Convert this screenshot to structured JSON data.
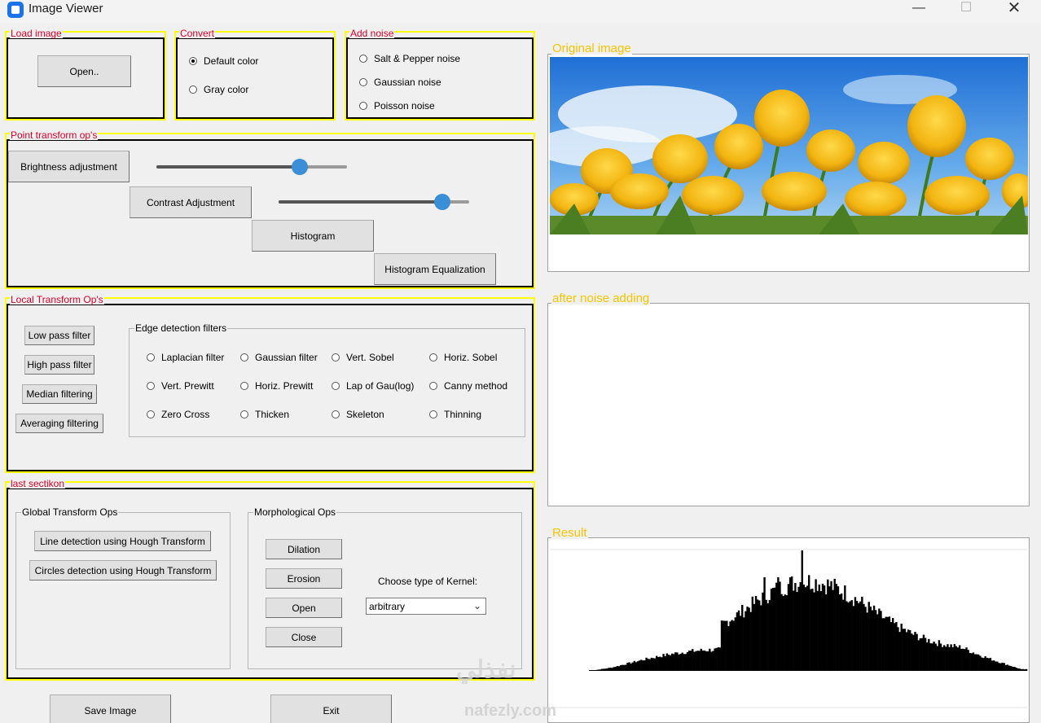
{
  "window": {
    "title": "Image Viewer"
  },
  "load_image": {
    "label": "Load image",
    "open_button": "Open.."
  },
  "convert": {
    "label": "Convert",
    "options": [
      "Default color",
      "Gray color"
    ],
    "selected": "Default color"
  },
  "add_noise": {
    "label": "Add noise",
    "options": [
      "Salt & Pepper noise",
      "Gaussian noise",
      "Poisson noise"
    ]
  },
  "point_transform": {
    "label": "Point transform op's",
    "brightness_button": "Brightness adjustment",
    "brightness_value": 0.75,
    "contrast_button": "Contrast Adjustment",
    "contrast_value": 0.86,
    "histogram_button": "Histogram",
    "hist_eq_button": "Histogram Equalization"
  },
  "local_transform": {
    "label": "Local Transform Op's",
    "buttons": [
      "Low pass filter",
      "High pass filter",
      "Median filtering",
      "Averaging filtering"
    ],
    "edge_group_label": "Edge detection filters",
    "edge_options": [
      "Laplacian filter",
      "Gaussian filter",
      "Vert. Sobel",
      "Horiz. Sobel",
      "Vert. Prewitt",
      "Horiz. Prewitt",
      "Lap of Gau(log)",
      "Canny method",
      "Zero Cross",
      "Thicken",
      "Skeleton",
      "Thinning"
    ]
  },
  "last_section": {
    "label": "last sectikon",
    "global_group_label": "Global Transform Ops",
    "global_buttons": [
      "Line detection using Hough Transform",
      "Circles detection using Hough Transform"
    ],
    "morph_group_label": "Morphological Ops",
    "morph_buttons": [
      "Dilation",
      "Erosion",
      "Open",
      "Close"
    ],
    "kernel_label": "Choose type of Kernel:",
    "kernel_value": "arbitrary"
  },
  "footer": {
    "save_button": "Save Image",
    "exit_button": "Exit"
  },
  "panels": {
    "original_label": "Original image",
    "noise_label": "after noise adding",
    "result_label": "Result"
  },
  "watermark": {
    "text": "نفذلي",
    "url": "nafezly.com"
  },
  "colors": {
    "section_border": "#ffff00",
    "section_label": "#d4002a",
    "panel_label": "#f5c400",
    "slider_thumb": "#3a8fd6"
  }
}
